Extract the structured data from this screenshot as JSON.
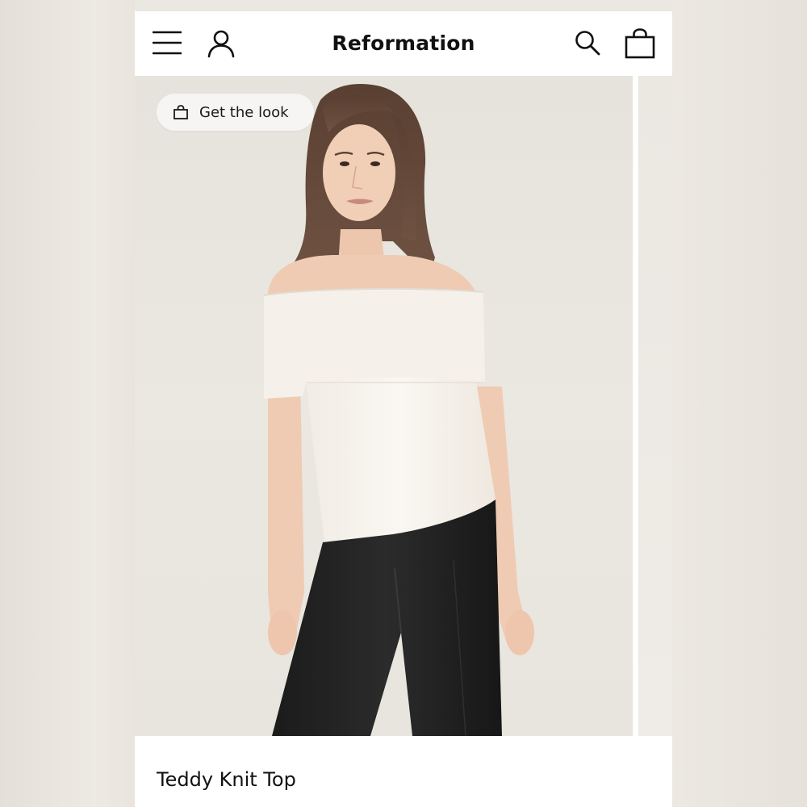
{
  "header": {
    "brand": "Reformation",
    "icons": [
      "menu-icon",
      "account-icon",
      "search-icon",
      "shopping-bag-icon"
    ]
  },
  "hero": {
    "get_the_look_label": "Get the look",
    "get_the_look_icon": "shopping-bag-icon",
    "image_description_icon": "product-photo"
  },
  "product": {
    "title": "Teddy Knit Top"
  },
  "colors": {
    "text": "#111111",
    "background": "#ffffff",
    "backdrop": "#ebe7e1"
  }
}
